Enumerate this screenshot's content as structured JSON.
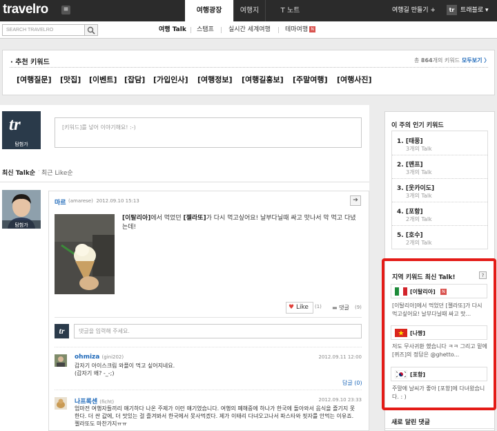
{
  "header": {
    "logo": "travelro",
    "tabs": [
      "여행광장",
      "여행지",
      "T 노트"
    ],
    "active_tab": "여행광장",
    "make_trip": "여행길 만들기 +",
    "user_avatar": "tr",
    "user_name": "트래블로 ▾"
  },
  "subbar": {
    "search_placeholder": "SEARCH TRAVELRO",
    "nav": [
      "여행 Talk",
      "스탬프",
      "실시간 세계여행",
      "테마여행"
    ],
    "new_badge": "N"
  },
  "keywords": {
    "title": "추천 키워드",
    "count_prefix": "총",
    "count": "864",
    "count_suffix": "개의 키워드",
    "more": "모두보기 〉",
    "items": [
      "[여행질문]",
      "[맛집]",
      "[이벤트]",
      "[잡담]",
      "[가입인사]",
      "[여행정보]",
      "[여행길홍보]",
      "[주말여행]",
      "[여행사진]"
    ]
  },
  "compose": {
    "avatar_text": "tr",
    "avatar_label": "탐험가",
    "placeholder": "[키워드]를 넣어 이야기해요! :-)"
  },
  "sort": {
    "latest": "최신 Talk순",
    "like": "최근 Like순"
  },
  "post": {
    "avatar_label": "탐험가",
    "author": "마르",
    "author_id": "(amarese)",
    "date": "2012.09.10 15:13",
    "text_pre": "[이탈리아]",
    "text_mid": "에서 먹었던 ",
    "text_kw": "[젤라또]",
    "text_post": "가 다시 먹고싶어요! 날부다닐때 싸고 맛나서 막 먹고 다녔는데!",
    "like_label": "Like",
    "like_count": "(1)",
    "comment_label": "댓글",
    "comment_count": "(9)",
    "comment_placeholder": "댓글을 입력해 주세요.",
    "reply_label": "답글 (0)",
    "comments": [
      {
        "name": "ohmiza",
        "id": "(gini202)",
        "date": "2012.09.11 12:00",
        "text": "갑자기 아이스크림 와플이 먹고 싶어지네요.\n(갑자기 왜? -_-;)"
      },
      {
        "name": "나프록센",
        "id": "(ficht)",
        "date": "2012.09.10 23:33",
        "text": "엄마전 여행자들끼리 얘기하다 나온 주제가 이런 얘기였습니다. 여행의 폐해중에 하나가 한국에 돌아와서 음식을 즐기지 못한다. 더 싼 값에, 더 맛있는 걸 즐겨봐서 한국에서 못사먹겠다. 제가 이태리 다녀오고나서 파스타와 핏자를 안먹는 이유죠. 젤라또도 마찬가지ㅠㅠ"
      }
    ]
  },
  "popular": {
    "title": "이 주의 인기 키워드",
    "items": [
      {
        "rank": "1.",
        "keyword": "[태풍]",
        "count": "3개의 Talk"
      },
      {
        "rank": "2.",
        "keyword": "[맨프]",
        "count": "3개의 Talk"
      },
      {
        "rank": "3.",
        "keyword": "[옷카이도]",
        "count": "3개의 Talk"
      },
      {
        "rank": "4.",
        "keyword": "[포항]",
        "count": "2개의 Talk"
      },
      {
        "rank": "5.",
        "keyword": "[호수]",
        "count": "2개의 Talk"
      }
    ]
  },
  "regional": {
    "title": "지역 키워드 최신 Talk!",
    "help": "?",
    "items": [
      {
        "name": "[이탈리아]",
        "flag": "italy-flag",
        "badge": "N",
        "text": "[이탈리아]에서 먹었던 [젤라또]가 다시 먹고싶어요! 날부다닐때 싸고 맛..."
      },
      {
        "name": "[나짱]",
        "flag": "vietnam-flag",
        "text": "저도 무사귀환 했습니다 ㅋㅋ 그리고 밑에 [퀴즈]의 정답은 @ghetto..."
      },
      {
        "name": "[포항]",
        "flag": "korea-flag",
        "text": "주말에 날씨가 좋아 [포항]에 다녀왔습니다. : )"
      }
    ]
  },
  "new_comments": {
    "title": "새로 달린 댓글"
  },
  "colors": {
    "topbar": "#2b2b2b",
    "link": "#1a66b8",
    "highlight": "#e41b17"
  }
}
